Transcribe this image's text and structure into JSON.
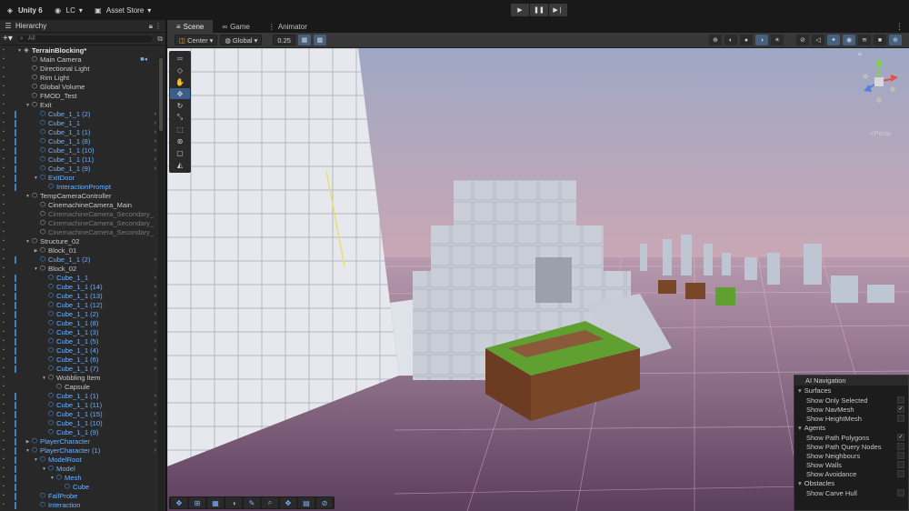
{
  "topbar": {
    "product": "Unity 6",
    "account": "LC",
    "asset_store": "Asset Store"
  },
  "hierarchy": {
    "tab_label": "Hierarchy",
    "search_placeholder": "All",
    "rows": [
      {
        "depth": 0,
        "label": "TerrainBlocking*",
        "style": "bold",
        "arrow": "▼",
        "icon": "scene"
      },
      {
        "depth": 1,
        "label": "Main Camera",
        "style": "",
        "icon": "go"
      },
      {
        "depth": 1,
        "label": "Directional Light",
        "style": "",
        "icon": "go"
      },
      {
        "depth": 1,
        "label": "Rim Light",
        "style": "",
        "icon": "go"
      },
      {
        "depth": 1,
        "label": "Global Volume",
        "style": "",
        "icon": "go"
      },
      {
        "depth": 1,
        "label": "FMOD_Test",
        "style": "",
        "icon": "go"
      },
      {
        "depth": 1,
        "label": "Exit",
        "style": "",
        "arrow": "▼",
        "icon": "go"
      },
      {
        "depth": 2,
        "label": "Cube_1_1 (2)",
        "style": "blue",
        "icon": "prefab",
        "chev": true
      },
      {
        "depth": 2,
        "label": "Cube_1_1",
        "style": "blue",
        "icon": "prefab",
        "chev": true
      },
      {
        "depth": 2,
        "label": "Cube_1_1 (1)",
        "style": "blue",
        "icon": "prefab",
        "chev": true
      },
      {
        "depth": 2,
        "label": "Cube_1_1 (8)",
        "style": "blue",
        "icon": "prefab",
        "chev": true
      },
      {
        "depth": 2,
        "label": "Cube_1_1 (10)",
        "style": "blue",
        "icon": "prefab",
        "chev": true
      },
      {
        "depth": 2,
        "label": "Cube_1_1 (11)",
        "style": "blue",
        "icon": "prefab",
        "chev": true
      },
      {
        "depth": 2,
        "label": "Cube_1_1 (9)",
        "style": "blue",
        "icon": "prefab",
        "chev": true
      },
      {
        "depth": 2,
        "label": "ExitDoor",
        "style": "blue",
        "arrow": "▼",
        "icon": "prefab"
      },
      {
        "depth": 3,
        "label": "InteractionPrompt",
        "style": "blue",
        "icon": "prefab"
      },
      {
        "depth": 1,
        "label": "TempCameraController",
        "style": "",
        "arrow": "▼",
        "icon": "go"
      },
      {
        "depth": 2,
        "label": "CinemachineCamera_Main",
        "style": "",
        "icon": "go"
      },
      {
        "depth": 2,
        "label": "CinemachineCamera_Secondary_",
        "style": "dim",
        "icon": "go"
      },
      {
        "depth": 2,
        "label": "CinemachineCamera_Secondary_",
        "style": "dim",
        "icon": "go"
      },
      {
        "depth": 2,
        "label": "CinemachineCamera_Secondary_",
        "style": "dim",
        "icon": "go"
      },
      {
        "depth": 1,
        "label": "Structure_02",
        "style": "",
        "arrow": "▼",
        "icon": "go"
      },
      {
        "depth": 2,
        "label": "Block_01",
        "style": "",
        "arrow": "▶",
        "icon": "go"
      },
      {
        "depth": 2,
        "label": "Cube_1_1 (2)",
        "style": "blue",
        "icon": "prefab",
        "chev": true
      },
      {
        "depth": 2,
        "label": "Block_02",
        "style": "",
        "arrow": "▼",
        "icon": "go"
      },
      {
        "depth": 3,
        "label": "Cube_1_1",
        "style": "blue",
        "icon": "prefab",
        "chev": true
      },
      {
        "depth": 3,
        "label": "Cube_1_1 (14)",
        "style": "blue",
        "icon": "prefab",
        "chev": true
      },
      {
        "depth": 3,
        "label": "Cube_1_1 (13)",
        "style": "blue",
        "icon": "prefab",
        "chev": true
      },
      {
        "depth": 3,
        "label": "Cube_1_1 (12)",
        "style": "blue",
        "icon": "prefab",
        "chev": true
      },
      {
        "depth": 3,
        "label": "Cube_1_1 (2)",
        "style": "blue",
        "icon": "prefab",
        "chev": true
      },
      {
        "depth": 3,
        "label": "Cube_1_1 (8)",
        "style": "blue",
        "icon": "prefab",
        "chev": true
      },
      {
        "depth": 3,
        "label": "Cube_1_1 (3)",
        "style": "blue",
        "icon": "prefab",
        "chev": true
      },
      {
        "depth": 3,
        "label": "Cube_1_1 (5)",
        "style": "blue",
        "icon": "prefab",
        "chev": true
      },
      {
        "depth": 3,
        "label": "Cube_1_1 (4)",
        "style": "blue",
        "icon": "prefab",
        "chev": true
      },
      {
        "depth": 3,
        "label": "Cube_1_1 (6)",
        "style": "blue",
        "icon": "prefab",
        "chev": true
      },
      {
        "depth": 3,
        "label": "Cube_1_1 (7)",
        "style": "blue",
        "icon": "prefab",
        "chev": true
      },
      {
        "depth": 3,
        "label": "Wobbling Item",
        "style": "",
        "arrow": "▼",
        "icon": "go"
      },
      {
        "depth": 4,
        "label": "Capsule",
        "style": "",
        "icon": "go"
      },
      {
        "depth": 3,
        "label": "Cube_1_1 (1)",
        "style": "blue",
        "icon": "prefab",
        "chev": true
      },
      {
        "depth": 3,
        "label": "Cube_1_1 (11)",
        "style": "blue",
        "icon": "prefab",
        "chev": true
      },
      {
        "depth": 3,
        "label": "Cube_1_1 (15)",
        "style": "blue",
        "icon": "prefab",
        "chev": true
      },
      {
        "depth": 3,
        "label": "Cube_1_1 (10)",
        "style": "blue",
        "icon": "prefab",
        "chev": true
      },
      {
        "depth": 3,
        "label": "Cube_1_1 (9)",
        "style": "blue",
        "icon": "prefab",
        "chev": true
      },
      {
        "depth": 1,
        "label": "PlayerCharacter",
        "style": "blue",
        "arrow": "▶",
        "icon": "prefab",
        "chev": true
      },
      {
        "depth": 1,
        "label": "PlayerCharacter (1)",
        "style": "blue",
        "arrow": "▼",
        "icon": "prefab",
        "chev": true
      },
      {
        "depth": 2,
        "label": "ModelRoot",
        "style": "blue",
        "arrow": "▼",
        "icon": "prefab"
      },
      {
        "depth": 3,
        "label": "Model",
        "style": "blue",
        "arrow": "▼",
        "icon": "prefab"
      },
      {
        "depth": 4,
        "label": "Mesh",
        "style": "blue",
        "arrow": "▼",
        "icon": "prefab"
      },
      {
        "depth": 5,
        "label": "Cube",
        "style": "blue",
        "icon": "prefab"
      },
      {
        "depth": 2,
        "label": "FallProbe",
        "style": "blue",
        "icon": "prefab"
      },
      {
        "depth": 2,
        "label": "Interaction",
        "style": "blue",
        "icon": "prefab"
      }
    ]
  },
  "scene": {
    "tabs": [
      {
        "label": "Scene",
        "icon": "≡"
      },
      {
        "label": "Game",
        "icon": "∞"
      },
      {
        "label": "Animator",
        "icon": "⋮"
      }
    ],
    "pivot_mode": "Center",
    "pivot_rotation": "Global",
    "snap_value": "0.25",
    "persp_label": "≺Persp"
  },
  "ai_navigation": {
    "title": "AI Navigation",
    "sections": [
      {
        "name": "Surfaces",
        "options": [
          {
            "label": "Show Only Selected",
            "checked": false
          },
          {
            "label": "Show NavMesh",
            "checked": true
          },
          {
            "label": "Show HeightMesh",
            "checked": false
          }
        ]
      },
      {
        "name": "Agents",
        "options": [
          {
            "label": "Show Path Polygons",
            "checked": true
          },
          {
            "label": "Show Path Query Nodes",
            "checked": false
          },
          {
            "label": "Show Neighbours",
            "checked": false
          },
          {
            "label": "Show Walls",
            "checked": false
          },
          {
            "label": "Show Avoidance",
            "checked": false
          }
        ]
      },
      {
        "name": "Obstacles",
        "options": [
          {
            "label": "Show Carve Hull",
            "checked": false
          }
        ]
      }
    ]
  },
  "colors": {
    "accent": "#3a5f8d",
    "prefab_blue": "#6cb2ff"
  }
}
